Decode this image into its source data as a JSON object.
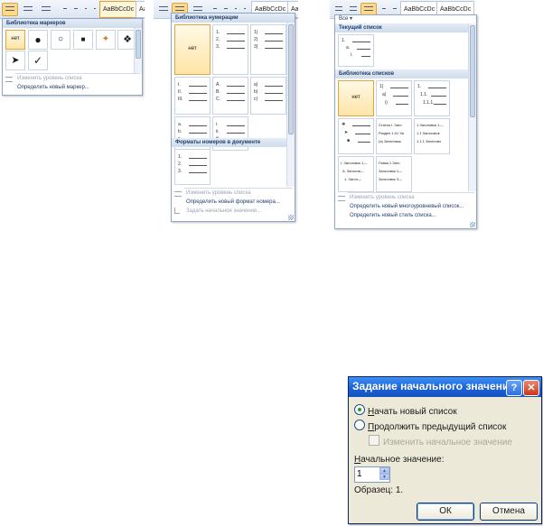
{
  "ribbon": {
    "style_sample": "AaBbCcDc",
    "style_sample_cut": "AaBbCcDc",
    "style_sample_partial": "AaB"
  },
  "bullets_gallery": {
    "title": "Библиотека маркеров",
    "none_label": "нет",
    "symbols": [
      "●",
      "○",
      "■",
      "✦",
      "❖",
      "➤",
      "✓"
    ],
    "menu": {
      "change_level": "Изменить уровень списка",
      "define_new": "Определить новый маркер..."
    }
  },
  "numbering_gallery": {
    "title": "Библиотека нумерации",
    "none_label": "нет",
    "formats": [
      [
        "1.",
        "2.",
        "3."
      ],
      [
        "1)",
        "2)",
        "3)"
      ],
      [
        "I.",
        "II.",
        "III."
      ],
      [
        "A.",
        "B.",
        "C."
      ],
      [
        "a)",
        "b)",
        "c)"
      ],
      [
        "a.",
        "b.",
        "c."
      ],
      [
        "i.",
        "ii.",
        "iii."
      ]
    ],
    "doc_section_title": "Форматы номеров в документе",
    "doc_format": [
      "1.",
      "2.",
      "3."
    ],
    "menu": {
      "change_level": "Изменить уровень списка",
      "define_new": "Определить новый формат номера...",
      "set_value": "Задать начальное значение..."
    }
  },
  "multilevel_gallery": {
    "header_label": "Все ▾",
    "current_title": "Текущий список",
    "current_levels": [
      "1.",
      "a.",
      "i."
    ],
    "library_title": "Библиотека списков",
    "none_label": "нет",
    "lists": [
      [
        "1)",
        "a)",
        "i)"
      ],
      [
        "1.",
        "1.1.",
        "1.1.1."
      ],
      [
        "❖",
        "➤",
        "■"
      ],
      [
        "Статья I. Заго",
        "Раздел 1.01 За",
        "(a) Заголовок"
      ],
      [
        "1 Заголовок 1—",
        "1.1 Заголовок",
        "1.1.1 Заголово"
      ],
      [
        "I. Заголовок 1—",
        "A. Заголов—",
        "1. Загол—"
      ],
      [
        "Глава 1 Заго",
        "Заголовок 1—",
        "Заголовок 3—"
      ]
    ],
    "menu": {
      "change_level": "Изменить уровень списка",
      "define_new_multilevel": "Определить новый многоуровневый список...",
      "define_new_style": "Определить новый стиль списка..."
    }
  },
  "dialog": {
    "title": "Задание начального значения",
    "help_label": "?",
    "close_label": "✕",
    "radio_start_new_u": "Н",
    "radio_start_new_rest": "ачать новый список",
    "radio_start_new_selected": true,
    "radio_continue_u": "П",
    "radio_continue_rest": "родолжить предыдущий список",
    "check_advance": "Изменить начальное значение",
    "start_value_label_u": "Н",
    "start_value_label_rest": "ачальное значение:",
    "start_value": "1",
    "preview": "Образец: 1.",
    "ok_label": "ОК",
    "cancel_label": "Отмена"
  },
  "colors": {
    "accent_selected": "#ffd98a",
    "panel_border": "#8ea7c8",
    "titlebar_blue": "#1a5fd4"
  }
}
